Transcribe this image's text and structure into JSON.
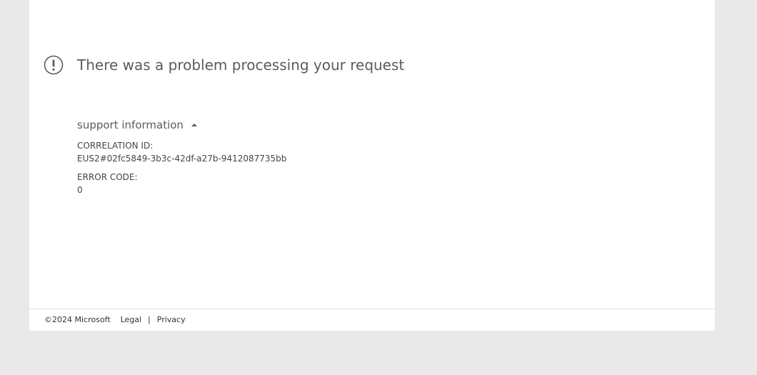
{
  "error": {
    "title": "There was a problem processing your request",
    "icon": "exclamation-circle-icon",
    "icon_color": "#595c5f"
  },
  "support": {
    "toggle_label": "support information",
    "toggle_icon": "caret-up-icon",
    "fields": [
      {
        "label": "CORRELATION ID:",
        "value": "EUS2#02fc5849-3b3c-42df-a27b-9412087735bb"
      },
      {
        "label": "ERROR CODE:",
        "value": "0"
      }
    ]
  },
  "footer": {
    "copyright": "©2024 Microsoft",
    "links": [
      {
        "label": "Legal"
      },
      {
        "label": "Privacy"
      }
    ],
    "separator": "|"
  },
  "colors": {
    "page_background": "#e9e9e9",
    "card_background": "#ffffff",
    "text_primary": "#595c5f"
  }
}
